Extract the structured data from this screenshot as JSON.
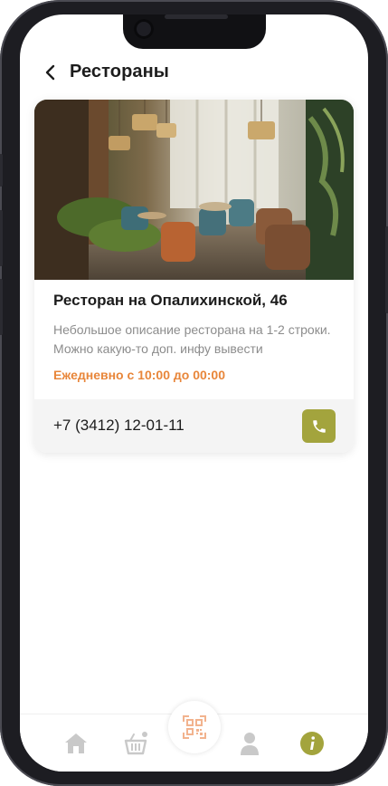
{
  "header": {
    "title": "Рестораны",
    "back_icon": "chevron-left-icon"
  },
  "restaurant": {
    "name": "Ресторан на Опалихинской, 46",
    "description": "Небольшое описание ресторана на 1-2 строки. Можно какую-то доп. инфу вывести",
    "hours": "Ежедневно с 10:00 до 00:00",
    "phone": "+7 (3412) 12-01-11",
    "call_icon": "phone-icon",
    "photo": "restaurant-interior-photo"
  },
  "tabbar": {
    "items": [
      {
        "icon": "home-icon",
        "active": false
      },
      {
        "icon": "basket-icon",
        "active": false,
        "has_badge": true
      },
      {
        "icon": "qr-code-icon",
        "active": false
      },
      {
        "icon": "user-icon",
        "active": false
      },
      {
        "icon": "info-icon",
        "active": true
      }
    ]
  },
  "colors": {
    "accent": "#a3a43d",
    "hours_text": "#e8863a",
    "inactive_icon": "#c9c9c9",
    "qr_icon": "#f2b38e"
  }
}
